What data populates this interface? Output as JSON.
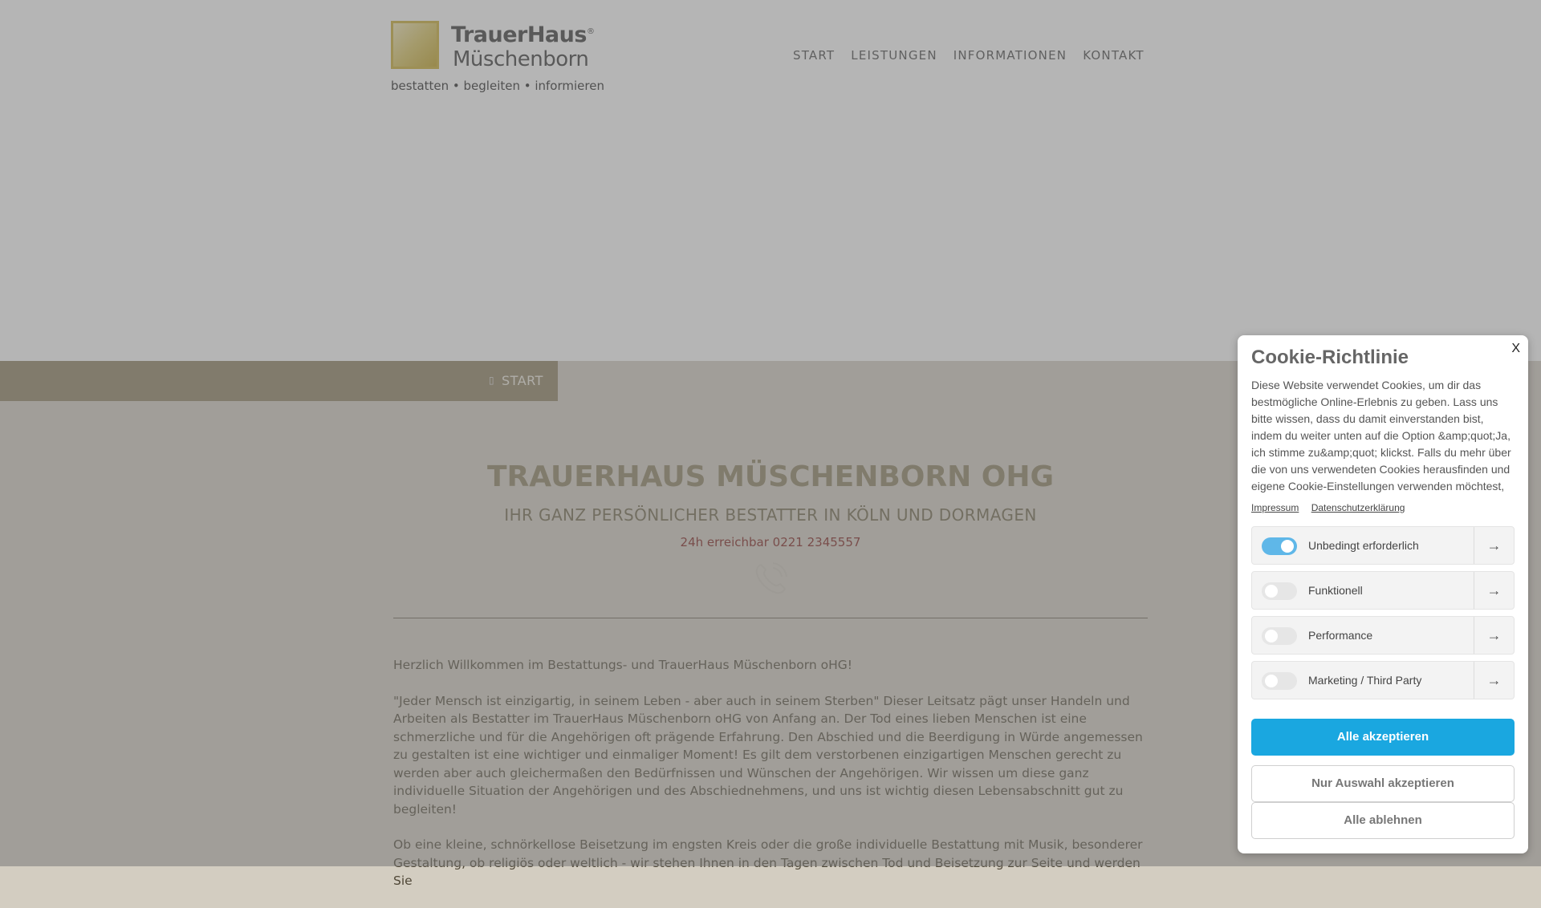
{
  "header": {
    "logo": {
      "title": "TrauerHaus",
      "registered": "®",
      "subtitle": "Müschenborn",
      "tagline": "bestatten • begleiten • informieren"
    },
    "nav": [
      {
        "label": "START"
      },
      {
        "label": "LEISTUNGEN"
      },
      {
        "label": "INFORMATIONEN"
      },
      {
        "label": "KONTAKT"
      }
    ]
  },
  "breadcrumb": {
    "label": "START"
  },
  "main": {
    "title": "TRAUERHAUS MÜSCHENBORN OHG",
    "subtitle": "IHR GANZ PERSÖNLICHER BESTATTER IN KÖLN UND DORMAGEN",
    "contact": "24h erreichbar 0221 2345557",
    "paragraphs": [
      "Herzlich Willkommen im Bestattungs- und TrauerHaus Müschenborn oHG!",
      "\"Jeder Mensch ist einzigartig, in seinem Leben - aber auch in seinem Sterben\" Dieser Leitsatz pägt unser Handeln und Arbeiten als Bestatter im TrauerHaus Müschenborn oHG von Anfang an. Der Tod eines lieben Menschen ist eine schmerzliche und für die Angehörigen oft prägende Erfahrung. Den Abschied und die Beerdigung in Würde angemessen zu gestalten ist eine wichtiger und einmaliger Moment! Es gilt dem verstorbenen einzigartigen Menschen gerecht zu werden aber auch gleichermaßen den Bedürfnissen und Wünschen der Angehörigen. Wir wissen um diese ganz individuelle Situation der Angehörigen und des Abschiednehmens, und uns ist wichtig diesen Lebensabschnitt gut zu begleiten!",
      "Ob eine kleine, schnörkellose Beisetzung im engsten Kreis oder die große individuelle Bestattung mit Musik, besonderer Gestaltung, ob religiös oder weltlich - wir stehen Ihnen in den Tagen zwischen Tod und Beisetzung zur Seite und werden Sie"
    ]
  },
  "cookie": {
    "close": "X",
    "title": "Cookie-Richtlinie",
    "text": "Diese Website verwendet Cookies, um dir das bestmögliche Online-Erlebnis zu geben. Lass uns bitte wissen, dass du damit einverstanden bist, indem du weiter unten auf die Option &amp;quot;Ja, ich stimme zu&amp;quot; klickst. Falls du mehr über die von uns verwendeten Cookies herausfinden und eigene Cookie-Einstellungen verwenden möchtest,",
    "links": [
      "Impressum",
      "Datenschutzerklärung"
    ],
    "categories": [
      {
        "label": "Unbedingt erforderlich",
        "enabled": true
      },
      {
        "label": "Funktionell",
        "enabled": false
      },
      {
        "label": "Performance",
        "enabled": false
      },
      {
        "label": "Marketing / Third Party",
        "enabled": false
      }
    ],
    "accept_all": "Alle akzeptieren",
    "accept_selection": "Nur Auswahl akzeptieren",
    "reject_all": "Alle ablehnen",
    "accent_color": "#1aa7e0"
  }
}
